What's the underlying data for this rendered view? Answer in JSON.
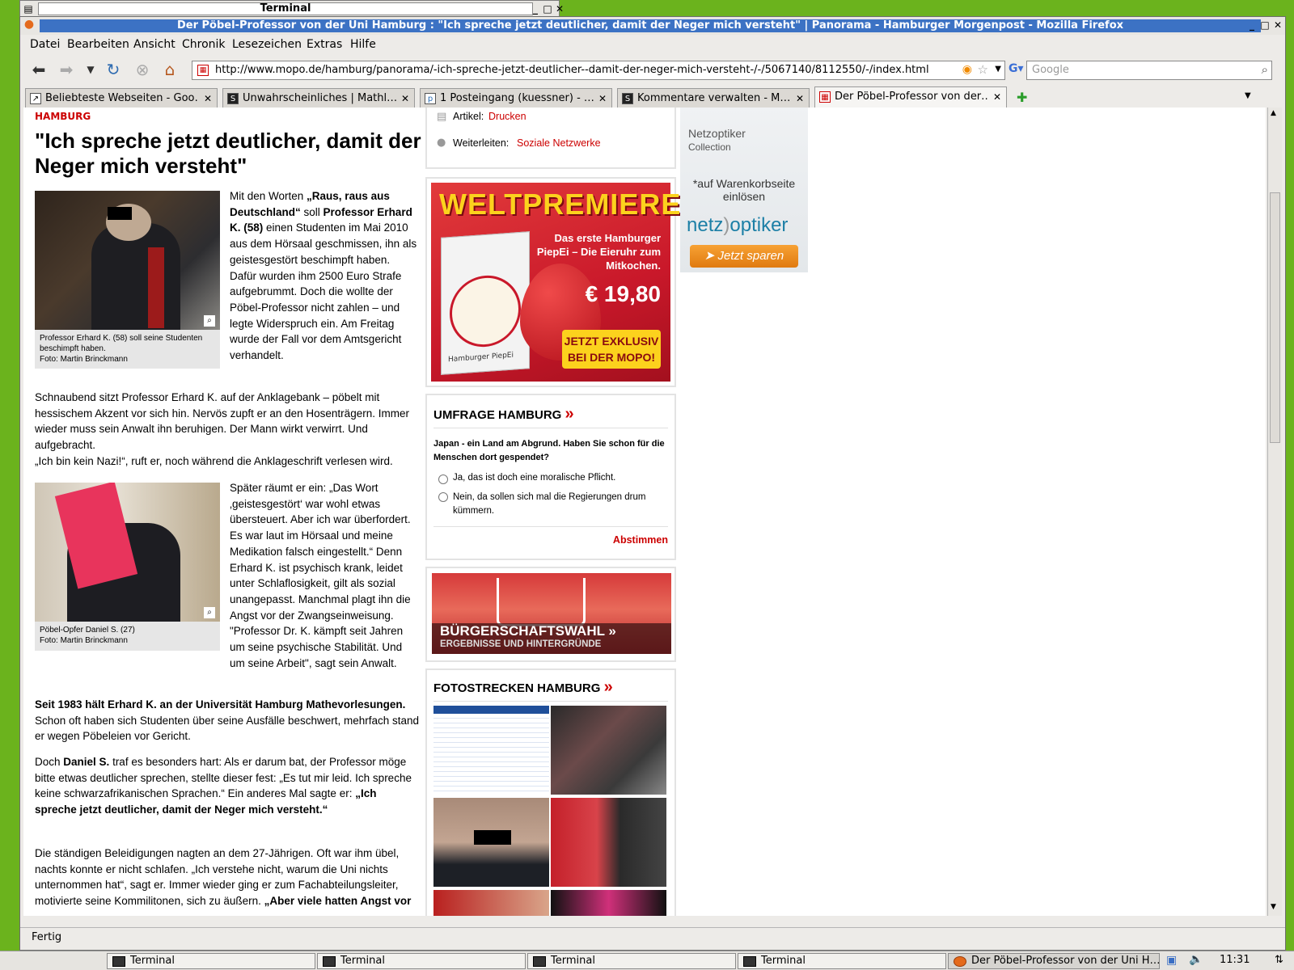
{
  "terminal_window": {
    "title": "Terminal"
  },
  "window": {
    "title": "Der Pöbel-Professor von der Uni Hamburg : \"Ich spreche jetzt deutlicher, damit der Neger mich versteht\" | Panorama - Hamburger Morgenpost - Mozilla Firefox"
  },
  "menu": [
    "Datei",
    "Bearbeiten",
    "Ansicht",
    "Chronik",
    "Lesezeichen",
    "Extras",
    "Hilfe"
  ],
  "url": "http://www.mopo.de/hamburg/panorama/-ich-spreche-jetzt-deutlicher--damit-der-neger-mich-versteht-/-/5067140/8112550/-/index.html",
  "search_placeholder": "Google",
  "tabs": [
    {
      "label": "Beliebteste Webseiten - Goo…",
      "icon": "chart-icon"
    },
    {
      "label": "Unwahrscheinliches | Mathl…",
      "icon": "sb-icon"
    },
    {
      "label": "1 Posteingang (kuessner) - …",
      "icon": "pm-icon"
    },
    {
      "label": "Kommentare verwalten - M…",
      "icon": "sb-icon"
    },
    {
      "label": "Der Pöbel-Professor von der…",
      "icon": "mopo-icon"
    }
  ],
  "status": "Fertig",
  "article": {
    "section": "HAMBURG",
    "headline": "\"Ich spreche jetzt deutlicher, damit der Neger mich versteht\"",
    "p1_a": "Mit den Worten ",
    "p1_b": "„Raus, raus aus Deutschland“",
    "p1_c": " soll ",
    "p1_d": "Professor Erhard K. (58)",
    "p1_e": " einen Studenten im Mai 2010 aus dem Hörsaal geschmissen, ihn als geistesgestört beschimpft haben. Dafür wurden ihm 2500 Euro Strafe aufgebrummt. Doch die wollte der Pöbel-Professor nicht zahlen – und legte Widerspruch ein. Am Freitag wurde der Fall vor dem Amtsgericht verhandelt.",
    "caption1_line1": "Professor Erhard K. (58) soll seine Studenten beschimpft haben.",
    "caption1_line2": "Foto: Martin Brinckmann",
    "p2": "Schnaubend sitzt Professor Erhard K. auf der Anklagebank – pöbelt mit hessischem Akzent vor sich hin. Nervös zupft er an den Hosenträgern. Immer wieder muss sein Anwalt ihn beruhigen. Der Mann wirkt verwirrt. Und aufgebracht.",
    "p3": "„Ich bin kein Nazi!“, ruft er, noch während die Anklageschrift verlesen wird.",
    "p4": "Später räumt er ein: „Das Wort ‚geistesgestört‘ war wohl etwas übersteuert. Aber ich war überfordert. Es war laut im Hörsaal und meine Medikation falsch eingestellt.“ Denn Erhard K. ist psychisch krank, leidet unter Schlaflosigkeit, gilt als sozial unangepasst. Manchmal plagt ihn die Angst vor der Zwangseinweisung. \"Professor Dr. K. kämpft seit Jahren um seine psychische Stabilität. Und um seine Arbeit\", sagt sein Anwalt.",
    "caption2_line1": "Pöbel-Opfer Daniel S. (27)",
    "caption2_line2": "Foto: Martin Brinckmann",
    "p5_bold": "Seit 1983 hält Erhard K. an der Universität Hamburg Mathevorlesungen.",
    "p5_rest": " Schon oft haben sich Studenten über seine Ausfälle beschwert, mehrfach stand er wegen Pöbeleien vor Gericht.",
    "p6_a": "Doch ",
    "p6_b": "Daniel S.",
    "p6_c": " traf es besonders hart: Als er darum bat, der Professor möge bitte etwas deutlicher sprechen, stellte dieser fest: „Es tut mir leid. Ich spreche keine schwarzafrikanischen Sprachen.“ Ein anderes Mal sagte er: ",
    "p6_d": "„Ich spreche jetzt deutlicher, damit der Neger mich versteht.“",
    "p7_a": "Die ständigen Beleidigungen nagten an dem 27-Jährigen. Oft war ihm übel, nachts konnte er nicht schlafen. „Ich verstehe nicht, warum die Uni nichts unternommen hat“, sagt er. Immer wieder ging er zum Fachabteilungsleiter, motivierte seine Kommilitonen, sich zu äußern. ",
    "p7_b": "„Aber viele hatten Angst vor"
  },
  "sidebar": {
    "article_label": "Artikel:",
    "article_link": "Drucken",
    "forward_label": "Weiterleiten:",
    "forward_link": "Soziale Netzwerke",
    "ad": {
      "headline": "WELTPREMIERE!!!",
      "line1": "Das erste Hamburger",
      "line2": "PiepEi – Die Eieruhr zum",
      "line3": "Mitkochen.",
      "price": "€ 19,80",
      "cta1": "JETZT EXKLUSIV",
      "cta2": "BEI DER MOPO!",
      "box_text": "Hamburger PiepEi"
    },
    "poll": {
      "title": "UMFRAGE HAMBURG",
      "question": "Japan - ein Land am Abgrund. Haben Sie schon für die Menschen dort gespendet?",
      "option1": "Ja, das ist doch eine moralische Pflicht.",
      "option2": "Nein, da sollen sich mal die Regierungen drum kümmern.",
      "vote": "Abstimmen"
    },
    "election": {
      "title": "BÜRGERSCHAFTSWAHL »",
      "subtitle": "ERGEBNISSE UND HINTERGRÜNDE"
    },
    "gallery": {
      "title": "FOTOSTRECKEN HAMBURG"
    }
  },
  "netzoptiker": {
    "line1": "Netzoptiker",
    "line2": "Collection",
    "note1": "*auf Warenkorbseite",
    "note2": "einlösen",
    "logo_a": "netz",
    "logo_b": "optiker",
    "button": "➤ Jetzt sparen"
  },
  "taskbar": {
    "items": [
      "Terminal",
      "Terminal",
      "Terminal",
      "Terminal",
      "Der Pöbel-Professor von der Uni H…"
    ],
    "clock": "11:31"
  }
}
